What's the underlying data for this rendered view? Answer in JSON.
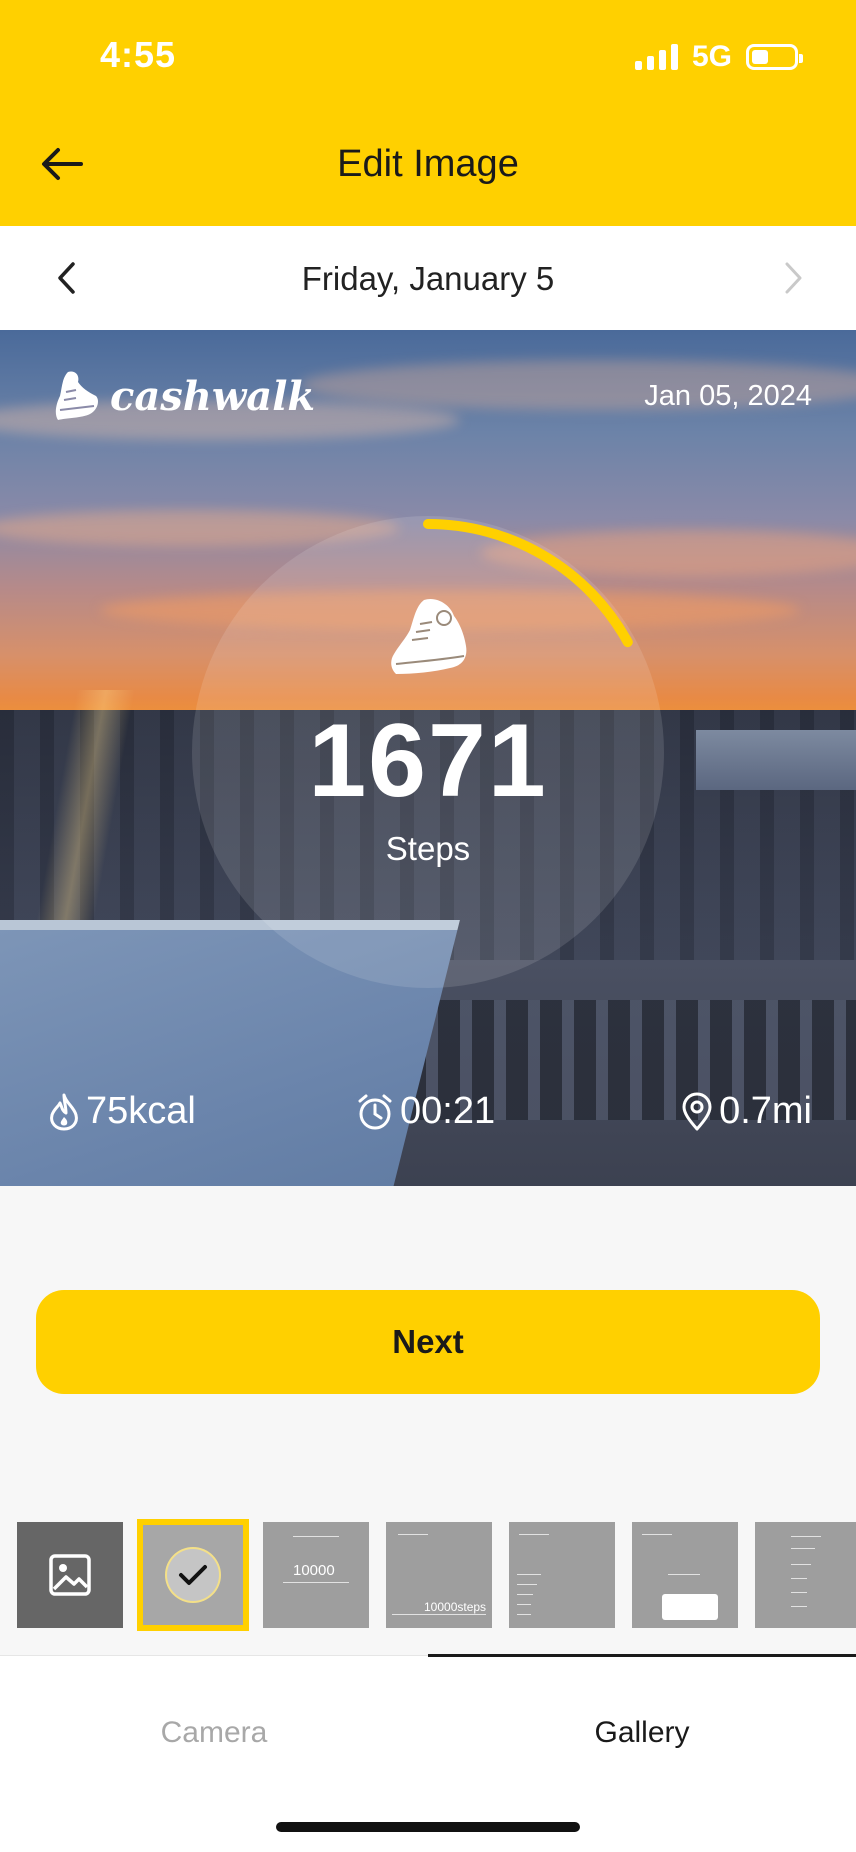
{
  "status_bar": {
    "time": "4:55",
    "network": "5G",
    "battery_level": 0.4
  },
  "header": {
    "title": "Edit Image",
    "back_icon": "arrow-left-icon"
  },
  "date_nav": {
    "label": "Friday, January 5",
    "prev_icon": "chevron-left-icon",
    "next_icon": "chevron-right-icon"
  },
  "photo": {
    "brand": "cashwalk",
    "date": "Jan 05, 2024",
    "steps": "1671",
    "steps_label": "Steps",
    "progress_fraction": 0.17,
    "stats": {
      "kcal": "75kcal",
      "time": "00:21",
      "distance": "0.7mi"
    },
    "accent_color": "#ffd000"
  },
  "next_button": {
    "label": "Next"
  },
  "templates": {
    "thumb3_value": "10000",
    "thumb4_value": "10000steps"
  },
  "tabs": {
    "camera": "Camera",
    "gallery": "Gallery",
    "active": "Gallery"
  }
}
